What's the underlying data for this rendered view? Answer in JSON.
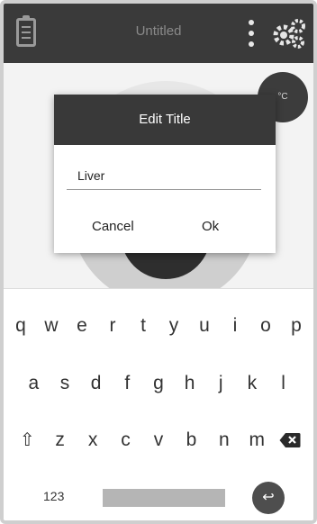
{
  "appbar": {
    "title": "Untitled",
    "icons": [
      "clipboard-icon",
      "more-vertical-icon",
      "settings-gears-icon"
    ]
  },
  "canvas": {
    "temperature_label": "°C"
  },
  "dialog": {
    "title": "Edit Title",
    "input_value": "Liver",
    "cancel_label": "Cancel",
    "ok_label": "Ok"
  },
  "keyboard": {
    "row1": [
      "q",
      "w",
      "e",
      "r",
      "t",
      "y",
      "u",
      "i",
      "o",
      "p"
    ],
    "row2": [
      "a",
      "s",
      "d",
      "f",
      "g",
      "h",
      "j",
      "k",
      "l"
    ],
    "row3": [
      "z",
      "x",
      "c",
      "v",
      "b",
      "n",
      "m"
    ],
    "shift_symbol": "⇧",
    "numbers_label": "123",
    "enter_symbol": "↩"
  },
  "colors": {
    "appbar_bg": "#3a3a3a",
    "dialog_header_bg": "#393939",
    "enter_key_bg": "#4e4e4e"
  }
}
